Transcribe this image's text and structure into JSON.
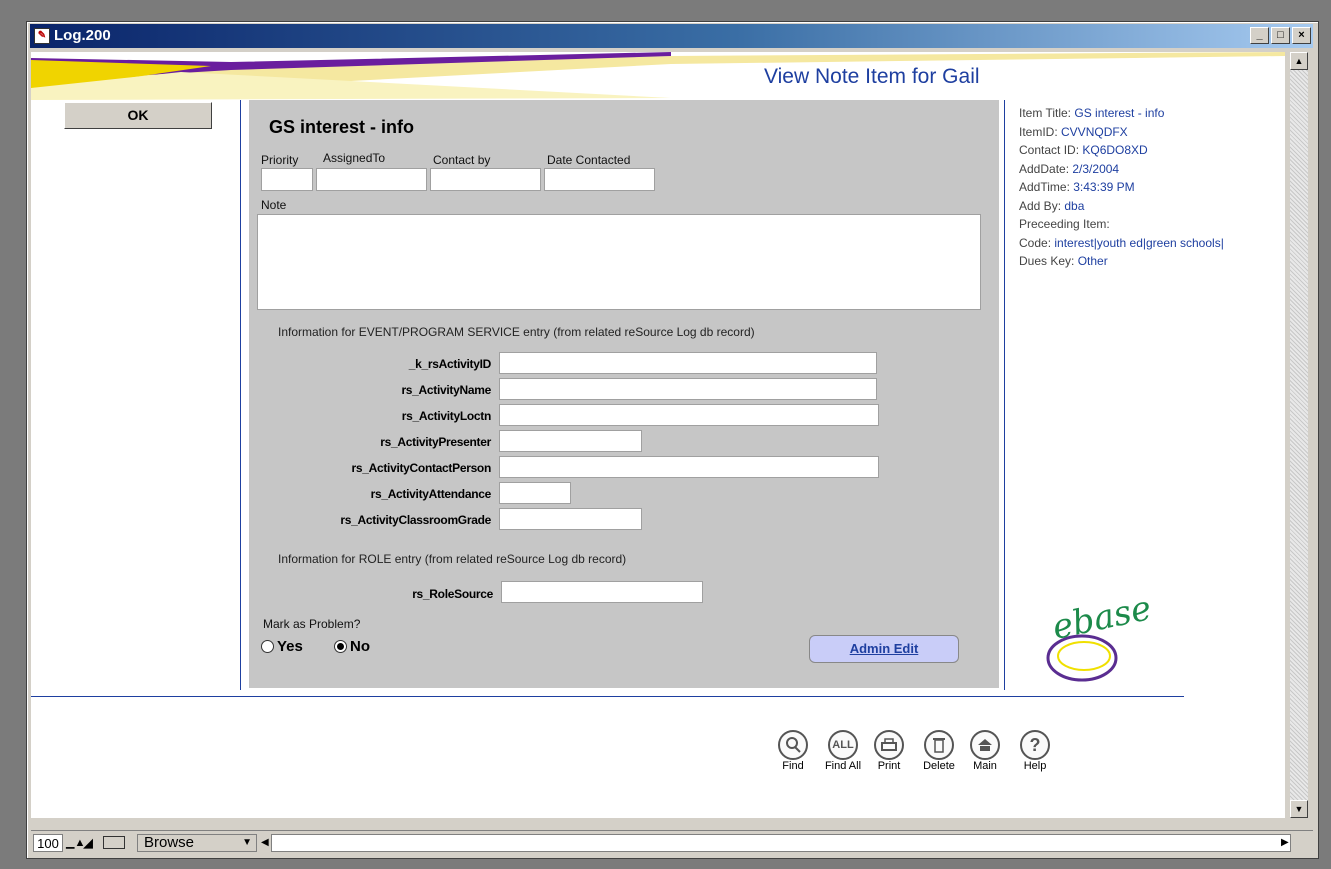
{
  "window": {
    "title": "Log.200",
    "controls": [
      "_",
      "□",
      "×"
    ]
  },
  "header": {
    "heading": "View Note Item  for Gail"
  },
  "ok_button": "OK",
  "note": {
    "title": "GS interest - info",
    "col_labels": {
      "priority": "Priority",
      "assigned_to": "AssignedTo",
      "contact_by": "Contact by",
      "date_contacted": "Date Contacted"
    },
    "note_label": "Note",
    "event_section": "Information for EVENT/PROGRAM SERVICE entry (from related reSource Log db record)",
    "event_fields": [
      "_k_rsActivityID",
      "rs_ActivityName",
      "rs_ActivityLoctn",
      "rs_ActivityPresenter",
      "rs_ActivityContactPerson",
      "rs_ActivityAttendance",
      "rs_ActivityClassroomGrade"
    ],
    "role_section": "Information for ROLE entry (from related reSource Log db record)",
    "role_field": "rs_RoleSource",
    "problem_label": "Mark as Problem?",
    "problem_options": [
      "Yes",
      "No"
    ],
    "problem_selected": "No",
    "admin_edit": "Admin Edit"
  },
  "item_info": [
    {
      "label": "Item Title: ",
      "value": "GS interest - info"
    },
    {
      "label": "ItemID: ",
      "value": "CVVNQDFX"
    },
    {
      "label": "Contact ID: ",
      "value": "KQ6DO8XD"
    },
    {
      "label": "AddDate: ",
      "value": "2/3/2004"
    },
    {
      "label": "AddTime: ",
      "value": "3:43:39 PM"
    },
    {
      "label": "Add By: ",
      "value": "dba"
    },
    {
      "label": "Preceeding Item:",
      "value": ""
    },
    {
      "label": "Code: ",
      "value": "interest|youth ed|green schools|"
    },
    {
      "label": "Dues Key: ",
      "value": "Other"
    }
  ],
  "logo": "ebase",
  "toolbar": [
    {
      "label": "Find",
      "icon": "magnifier-icon"
    },
    {
      "label": "Find All",
      "icon": "find-all-icon"
    },
    {
      "label": "Print",
      "icon": "printer-icon"
    },
    {
      "label": "Delete",
      "icon": "trash-icon"
    },
    {
      "label": "Main",
      "icon": "home-icon"
    },
    {
      "label": "Help",
      "icon": "question-icon"
    }
  ],
  "statusbar": {
    "zoom": "100",
    "mode": "Browse"
  },
  "colors": {
    "heading": "#1e3fa0",
    "panel": "#c6c6c6",
    "admin_button": "#c9cdf8",
    "info_value": "#1e3fa0"
  }
}
